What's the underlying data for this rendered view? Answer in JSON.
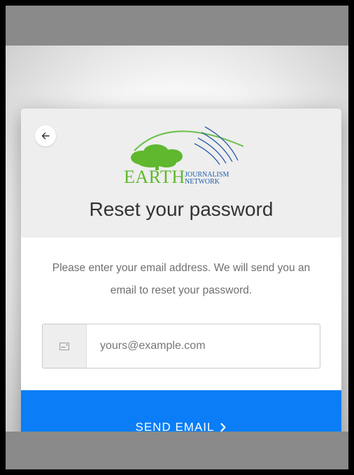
{
  "logo": {
    "brand": "EARTH",
    "sub_line1": "Journalism",
    "sub_line2": "Network",
    "colors": {
      "green": "#5fb82e",
      "blue": "#1e5fa8"
    }
  },
  "header": {
    "back_icon": "arrow-left-icon",
    "title": "Reset your password"
  },
  "body": {
    "description": "Please enter your email address. We will send you an email to reset your password."
  },
  "email": {
    "icon": "email-card-icon",
    "value": "",
    "placeholder": "yours@example.com"
  },
  "submit": {
    "label": "SEND EMAIL",
    "icon": "chevron-right-icon",
    "color": "#0a7df7"
  }
}
